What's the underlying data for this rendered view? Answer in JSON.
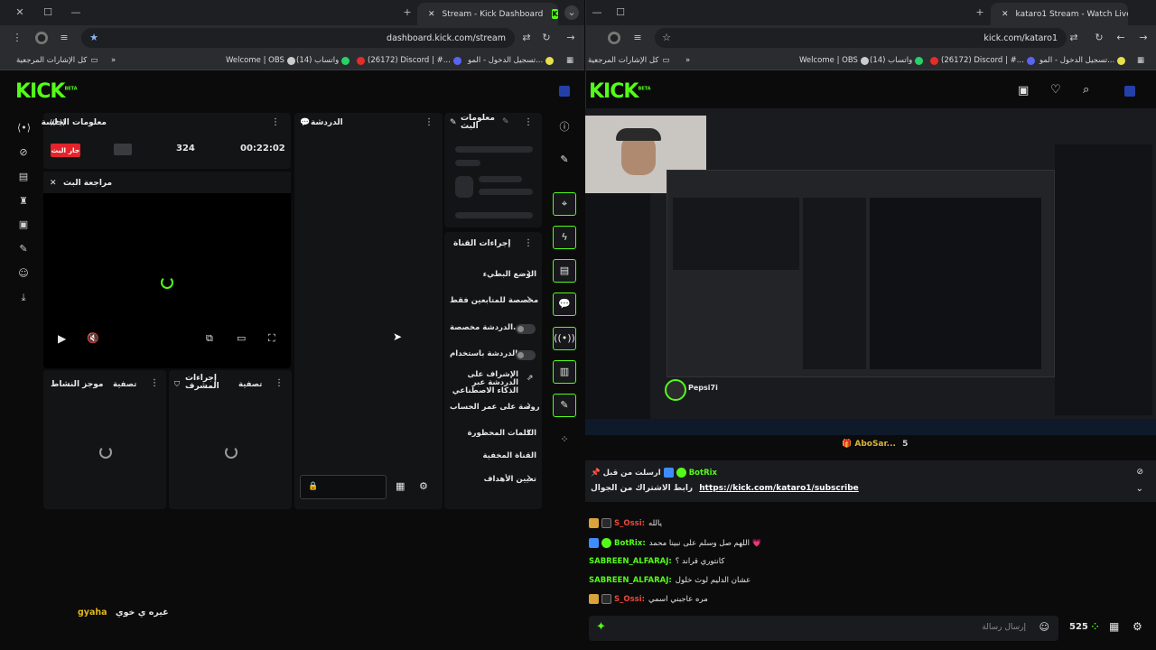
{
  "left_window": {
    "tab_title": "Stream - Kick Dashboard",
    "url": "dashboard.kick.com/stream",
    "bookmarks": [
      {
        "label": "كل الإشارات المرجعية"
      },
      {
        "label": "Welcome | OBS"
      },
      {
        "label": "واتساب (14)"
      },
      {
        "label": "(26172) Discord | #..."
      },
      {
        "label": "تسجيل الدخول - المو..."
      }
    ],
    "logo": "KICK",
    "logo_beta": "BETA",
    "session": {
      "title": "معلومات الجلسة",
      "live_badge": "جار البث",
      "viewers": "324",
      "duration": "00:22:02"
    },
    "preview_title": "مراجعة البث",
    "chat_title": "الدردشة",
    "stream_info_title": "معلومات البث",
    "actions_title": "إجراءات القناة",
    "actions": [
      {
        "label": "الوضع البطيء",
        "kind": "chevron"
      },
      {
        "label": "مخصصة للمتابعين فقط",
        "kind": "chevron"
      },
      {
        "label": "الدردشة مخصصة...",
        "kind": "toggle"
      },
      {
        "label": "الدردشة باستخدام...",
        "kind": "toggle"
      },
      {
        "label": "الإشراف على الدردشة عبر الذكاء الاصطناعي",
        "kind": "external"
      },
      {
        "label": "روضة على عمر الحساب",
        "kind": "chevron"
      },
      {
        "label": "الكلمات المحظورة",
        "kind": "chevron"
      },
      {
        "label": "القناة المخفية",
        "kind": "none"
      },
      {
        "label": "تعيين الأهداف",
        "kind": "chevron"
      }
    ],
    "activity_title": "موجز النشاط",
    "activity_filter": "تصفية",
    "mod_title": "إجراءات المشرف",
    "mod_filter": "تصفية",
    "overlay_user": "gyaha",
    "overlay_text": "غيره ي خوي"
  },
  "right_window": {
    "tab_title": "katarо1 Stream - Watch Live on",
    "url": "kick.com/kataro1",
    "bookmarks": [
      {
        "label": "كل الإشارات المرجعية"
      },
      {
        "label": "Welcome | OBS"
      },
      {
        "label": "واتساب (14)"
      },
      {
        "label": "(26172) Discord | #..."
      },
      {
        "label": "تسجيل الدخول - المو..."
      }
    ],
    "logo": "KICK",
    "logo_beta": "BETA",
    "gifter": "AboSar...",
    "gift_count": "5",
    "pinned": {
      "label": "ارسلت من قبل",
      "user": "BotRix",
      "text": "رابط الاشتراك من الجوال",
      "link": "https://kick.com/kataro1/subscribe"
    },
    "messages": [
      {
        "user": "S_Ossi:",
        "text": "يالله",
        "color": "#e8483a"
      },
      {
        "user": "BotRix:",
        "text": "اللهم صل وسلم على نبينا محمد 💗",
        "color": "#53fc18"
      },
      {
        "user": "SABREEN_ALFARAJ:",
        "text": "كانتوري قراند ؟",
        "color": "#53fc18"
      },
      {
        "user": "SABREEN_ALFARAJ:",
        "text": "عشان الدليم لوث خلول",
        "color": "#53fc18"
      },
      {
        "user": "S_Ossi:",
        "text": "مره عاجبني اسمي",
        "color": "#e8483a"
      }
    ],
    "chat_placeholder": "إرسال رسالة",
    "viewer_count": "525",
    "stream_user": "Pepsi7i"
  }
}
